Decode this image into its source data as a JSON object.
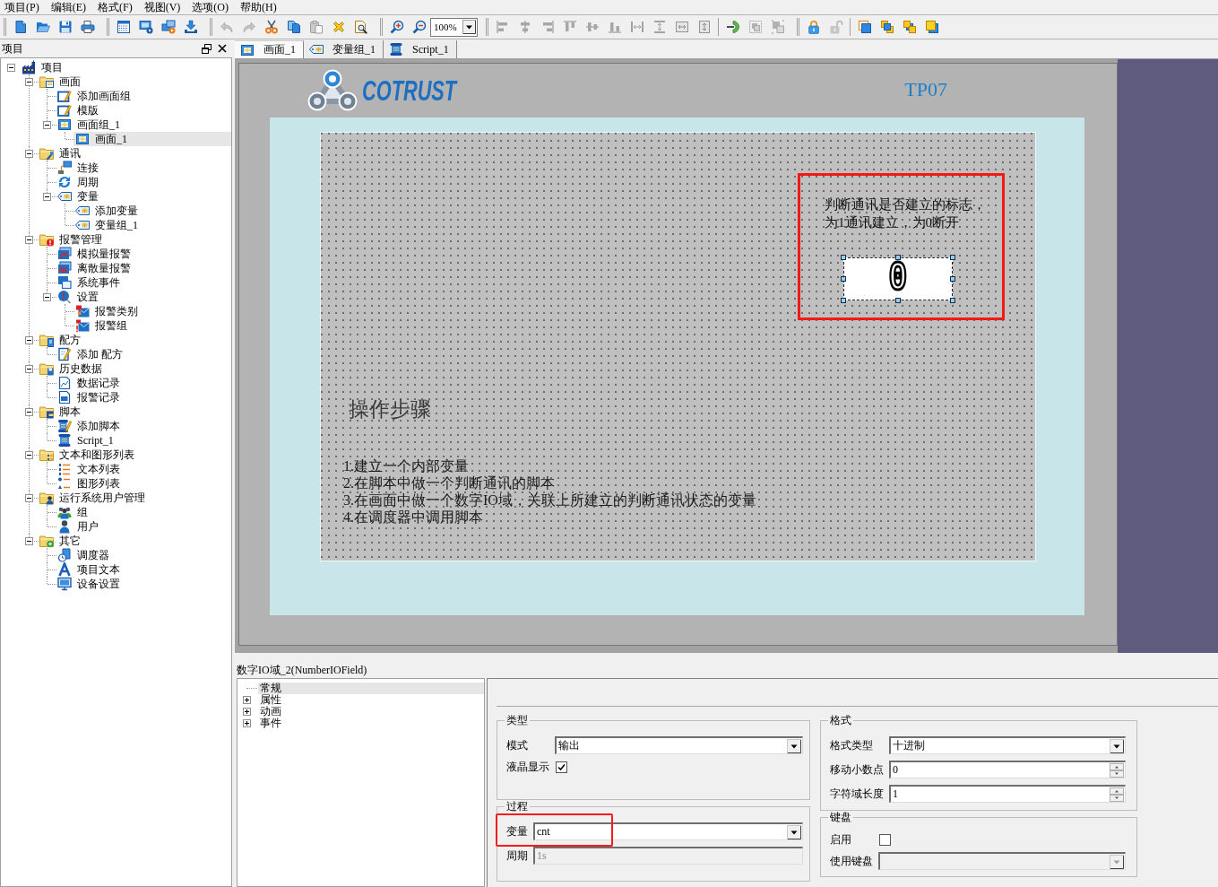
{
  "menu": [
    "项目(P)",
    "编辑(E)",
    "格式(F)",
    "视图(V)",
    "选项(O)",
    "帮助(H)"
  ],
  "toolbars": [
    {
      "sections": [
        [
          {
            "kind": "new",
            "disabled": false
          },
          {
            "kind": "open",
            "disabled": false
          },
          {
            "kind": "save",
            "disabled": false
          },
          {
            "kind": "print",
            "disabled": false
          }
        ]
      ]
    },
    {
      "sections": [
        [
          {
            "kind": "grid",
            "disabled": false
          },
          {
            "kind": "run",
            "disabled": false
          },
          {
            "kind": "transfer",
            "disabled": false
          },
          {
            "kind": "download",
            "disabled": false
          }
        ]
      ]
    },
    {
      "sections": [
        [
          {
            "kind": "undo",
            "disabled": true
          },
          {
            "kind": "redo",
            "disabled": true
          },
          {
            "kind": "cut",
            "disabled": false
          },
          {
            "kind": "copy",
            "disabled": false
          },
          {
            "kind": "paste",
            "disabled": true
          },
          {
            "kind": "delete",
            "disabled": false
          },
          {
            "kind": "find",
            "disabled": false
          }
        ]
      ]
    },
    {
      "sections": [
        [
          {
            "kind": "zoomin",
            "disabled": false
          },
          {
            "kind": "zoomout",
            "disabled": false
          }
        ]
      ],
      "zoom": "100%"
    },
    {
      "sections": [
        [
          {
            "kind": "alignleft",
            "disabled": true
          },
          {
            "kind": "aligncenter",
            "disabled": true
          },
          {
            "kind": "alignright",
            "disabled": true
          },
          {
            "kind": "aligntop",
            "disabled": true
          },
          {
            "kind": "alignmiddle",
            "disabled": true
          },
          {
            "kind": "alignbottom",
            "disabled": true
          },
          {
            "kind": "samewidth",
            "disabled": true
          },
          {
            "kind": "sameheight",
            "disabled": true
          },
          {
            "kind": "centerh",
            "disabled": true
          },
          {
            "kind": "centerv",
            "disabled": true
          }
        ],
        [
          {
            "kind": "arrow",
            "disabled": false
          },
          {
            "kind": "group",
            "disabled": true
          },
          {
            "kind": "ungroup",
            "disabled": true
          }
        ]
      ]
    },
    {
      "sections": [
        [
          {
            "kind": "lock",
            "disabled": false
          },
          {
            "kind": "unlock",
            "disabled": true
          }
        ],
        [
          {
            "kind": "front",
            "disabled": false
          },
          {
            "kind": "forward",
            "disabled": false
          },
          {
            "kind": "backward",
            "disabled": false
          },
          {
            "kind": "back",
            "disabled": false
          }
        ]
      ]
    }
  ],
  "project_panel": {
    "title": "项目",
    "tree": [
      {
        "label": "项目",
        "kind": "project",
        "selected": false,
        "expanded": true,
        "children": [
          {
            "label": "画面",
            "kind": "screens",
            "selected": false,
            "expanded": true,
            "children": [
              {
                "label": "添加画面组",
                "kind": "addgroup",
                "selected": false
              },
              {
                "label": "模版",
                "kind": "template",
                "selected": false
              },
              {
                "label": "画面组_1",
                "kind": "screengroup",
                "selected": false,
                "expanded": true,
                "children": [
                  {
                    "label": "画面_1",
                    "kind": "screen",
                    "selected": true
                  }
                ]
              }
            ]
          },
          {
            "label": "通讯",
            "kind": "comms",
            "selected": false,
            "expanded": true,
            "children": [
              {
                "label": "连接",
                "kind": "connection",
                "selected": false
              },
              {
                "label": "周期",
                "kind": "cycle",
                "selected": false
              },
              {
                "label": "变量",
                "kind": "tags",
                "selected": false,
                "expanded": true,
                "children": [
                  {
                    "label": "添加变量",
                    "kind": "tag",
                    "selected": false
                  },
                  {
                    "label": "变量组_1",
                    "kind": "tag",
                    "selected": false
                  }
                ]
              }
            ]
          },
          {
            "label": "报警管理",
            "kind": "alarms",
            "selected": false,
            "expanded": true,
            "children": [
              {
                "label": "模拟量报警",
                "kind": "analog",
                "selected": false
              },
              {
                "label": "离散量报警",
                "kind": "discrete",
                "selected": false
              },
              {
                "label": "系统事件",
                "kind": "events",
                "selected": false
              },
              {
                "label": "设置",
                "kind": "settings",
                "selected": false,
                "expanded": true,
                "children": [
                  {
                    "label": "报警类别",
                    "kind": "classes",
                    "selected": false
                  },
                  {
                    "label": "报警组",
                    "kind": "alarmgroups",
                    "selected": false
                  }
                ]
              }
            ]
          },
          {
            "label": "配方",
            "kind": "recipes",
            "selected": false,
            "expanded": true,
            "children": [
              {
                "label": "添加 配方",
                "kind": "addrecipe",
                "selected": false
              }
            ]
          },
          {
            "label": "历史数据",
            "kind": "history",
            "selected": false,
            "expanded": true,
            "children": [
              {
                "label": "数据记录",
                "kind": "datalog",
                "selected": false
              },
              {
                "label": "报警记录",
                "kind": "alarmlog",
                "selected": false
              }
            ]
          },
          {
            "label": "脚本",
            "kind": "scripts",
            "selected": false,
            "expanded": true,
            "children": [
              {
                "label": "添加脚本",
                "kind": "addscript",
                "selected": false
              },
              {
                "label": "Script_1",
                "kind": "script",
                "selected": false
              }
            ]
          },
          {
            "label": "文本和图形列表",
            "kind": "lists",
            "selected": false,
            "expanded": true,
            "children": [
              {
                "label": "文本列表",
                "kind": "textlist",
                "selected": false
              },
              {
                "label": "图形列表",
                "kind": "graphiclist",
                "selected": false
              }
            ]
          },
          {
            "label": "运行系统用户管理",
            "kind": "users",
            "selected": false,
            "expanded": true,
            "children": [
              {
                "label": "组",
                "kind": "usergroup",
                "selected": false
              },
              {
                "label": "用户",
                "kind": "user",
                "selected": false
              }
            ]
          },
          {
            "label": "其它",
            "kind": "other",
            "selected": false,
            "expanded": true,
            "children": [
              {
                "label": "调度器",
                "kind": "scheduler",
                "selected": false
              },
              {
                "label": "项目文本",
                "kind": "projecttext",
                "selected": false
              },
              {
                "label": "设备设置",
                "kind": "device",
                "selected": false
              }
            ]
          }
        ]
      }
    ]
  },
  "tabs": [
    {
      "label": "画面_1",
      "kind": "screen",
      "selected": true
    },
    {
      "label": "变量组_1",
      "kind": "tag",
      "selected": false
    },
    {
      "label": "Script_1",
      "kind": "script",
      "selected": false
    }
  ],
  "screen": {
    "logo_text": "COTRUST",
    "title": "TP07",
    "callout": {
      "framed": true,
      "text": "判断通讯是否建立的标志，为1通讯建立，为0断开",
      "field": {
        "value": "0",
        "selected": true
      }
    },
    "heading": "操作步骤",
    "steps": [
      "1.建立一个内部变量",
      "2.在脚本中做一个判断通讯的脚本",
      "3.在画面中做一个数字IO域，关联上所建立的判断通讯状态的变量",
      "4.在调度器中调用脚本"
    ]
  },
  "properties": {
    "title": "数字IO域_2(NumberIOField)",
    "nav": [
      {
        "label": "常规",
        "selected": true
      },
      {
        "label": "属性",
        "selected": false,
        "expanded": false
      },
      {
        "label": "动画",
        "selected": false,
        "expanded": false
      },
      {
        "label": "事件",
        "selected": false,
        "expanded": false
      }
    ],
    "columns": [
      [
        {
          "title": "类型",
          "rows": [
            {
              "kind": "dropdown",
              "label": "模式",
              "value": "输出",
              "disabled": false,
              "highlighted": false
            },
            {
              "kind": "checkbox",
              "label": "液晶显示",
              "checked": true,
              "disabled": false,
              "highlighted": false
            }
          ]
        },
        {
          "title": "过程",
          "rows": [
            {
              "kind": "dropdown",
              "label": "变量",
              "value": "cnt",
              "disabled": false,
              "highlighted": true
            },
            {
              "kind": "text",
              "label": "周期",
              "value": "1s",
              "disabled": true,
              "highlighted": false
            }
          ]
        }
      ],
      [
        {
          "title": "格式",
          "rows": [
            {
              "kind": "dropdown",
              "label": "格式类型",
              "value": "十进制",
              "disabled": false,
              "highlighted": false
            },
            {
              "kind": "spinner",
              "label": "移动小数点",
              "value": "0",
              "disabled": false,
              "highlighted": false
            },
            {
              "kind": "spinner",
              "label": "字符域长度",
              "value": "1",
              "disabled": false,
              "highlighted": false
            }
          ]
        },
        {
          "title": "键盘",
          "rows": [
            {
              "kind": "checkbox",
              "label": "启用",
              "checked": false,
              "disabled": false,
              "highlighted": false
            },
            {
              "kind": "dropdown",
              "label": "使用键盘",
              "disabled": true,
              "highlighted": false
            }
          ]
        }
      ]
    ]
  }
}
